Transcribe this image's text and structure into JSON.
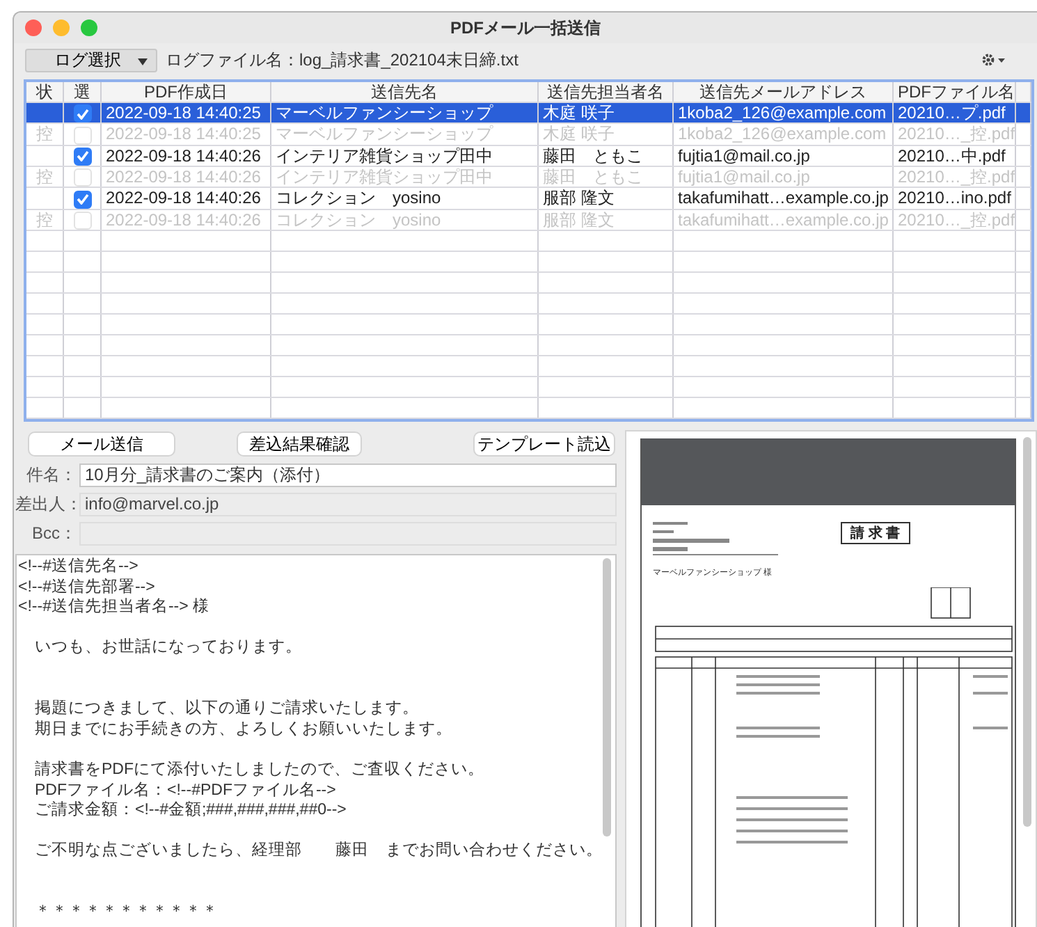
{
  "window": {
    "title": "PDFメール一括送信"
  },
  "toolbar": {
    "log_button": "ログ選択",
    "log_file_label": "ログファイル名：log_請求書_202104末日締.txt"
  },
  "table": {
    "columns": [
      "状",
      "選",
      "PDF作成日",
      "送信先名",
      "送信先担当者名",
      "送信先メールアドレス",
      "PDFファイル名"
    ],
    "rows": [
      {
        "status": "",
        "checked": true,
        "disabled": false,
        "selected": true,
        "date": "2022-09-18 14:40:25",
        "name": "マーベルファンシーショップ",
        "person": "木庭 咲子",
        "email": "1koba2_126@example.com",
        "file": "20210…プ.pdf"
      },
      {
        "status": "控",
        "checked": false,
        "disabled": true,
        "selected": false,
        "date": "2022-09-18 14:40:25",
        "name": "マーベルファンシーショップ",
        "person": "木庭 咲子",
        "email": "1koba2_126@example.com",
        "file": "20210…_控.pdf"
      },
      {
        "status": "",
        "checked": true,
        "disabled": false,
        "selected": false,
        "date": "2022-09-18 14:40:26",
        "name": "インテリア雑貨ショップ田中",
        "person": "藤田　ともこ",
        "email": "fujtia1@mail.co.jp",
        "file": "20210…中.pdf"
      },
      {
        "status": "控",
        "checked": false,
        "disabled": true,
        "selected": false,
        "date": "2022-09-18 14:40:26",
        "name": "インテリア雑貨ショップ田中",
        "person": "藤田　ともこ",
        "email": "fujtia1@mail.co.jp",
        "file": "20210…_控.pdf"
      },
      {
        "status": "",
        "checked": true,
        "disabled": false,
        "selected": false,
        "date": "2022-09-18 14:40:26",
        "name": "コレクション　yosino",
        "person": "服部 隆文",
        "email": "takafumihatt…example.co.jp",
        "file": "20210…ino.pdf"
      },
      {
        "status": "控",
        "checked": false,
        "disabled": true,
        "selected": false,
        "date": "2022-09-18 14:40:26",
        "name": "コレクション　yosino",
        "person": "服部 隆文",
        "email": "takafumihatt…example.co.jp",
        "file": "20210…_控.pdf"
      }
    ]
  },
  "buttons": [
    "メール送信",
    "差込結果確認",
    "テンプレート読込"
  ],
  "fields": [
    {
      "label": "件名：",
      "value": "10月分_請求書のご案内（添付）",
      "disabled": false
    },
    {
      "label": "差出人：",
      "value": "info@marvel.co.jp",
      "disabled": true
    },
    {
      "label": "Bcc：",
      "disabled": true
    }
  ],
  "body_lines": [
    {
      "kind": "text",
      "text": "<!--#送信先名-->"
    },
    {
      "kind": "text",
      "text": "<!--#送信先部署-->"
    },
    {
      "kind": "text",
      "text": "<!--#送信先担当者名--> 様"
    },
    {
      "kind": "gap"
    },
    {
      "kind": "text",
      "text": "　いつも、お世話になっております。"
    },
    {
      "kind": "gap"
    },
    {
      "kind": "gap"
    },
    {
      "kind": "text",
      "text": "　掲題につきまして、以下の通りご請求いたします。"
    },
    {
      "kind": "text",
      "text": "　期日までにお手続きの方、よろしくお願いいたします。"
    },
    {
      "kind": "gap"
    },
    {
      "kind": "text",
      "text": "　請求書をPDFにて添付いたしましたので、ご査収ください。"
    },
    {
      "kind": "text",
      "text": "　PDFファイル名：<!--#PDFファイル名-->"
    },
    {
      "kind": "text",
      "text": "　ご請求金額：<!--#金額;###,###,###,##0-->"
    },
    {
      "kind": "gap"
    },
    {
      "kind": "text",
      "text": "　ご不明な点ございましたら、経理部　　藤田　までお問い合わせください。"
    },
    {
      "kind": "gap"
    },
    {
      "kind": "gap"
    },
    {
      "kind": "text",
      "text": "　＊＊＊＊＊＊＊＊＊＊＊"
    }
  ],
  "preview": {
    "title": "請 求 書",
    "customer": "マーベルファンシーショップ 様"
  }
}
